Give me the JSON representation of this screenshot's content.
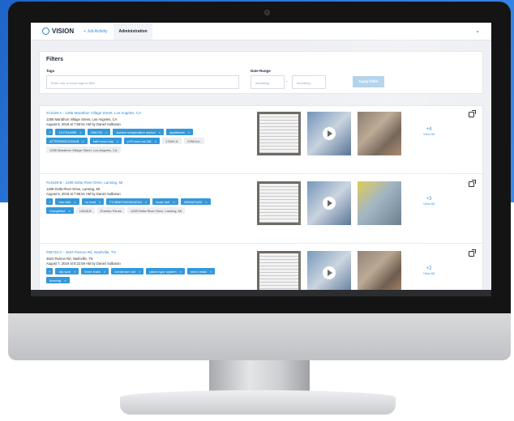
{
  "colors": {
    "accent": "#2d8ad8",
    "tag": "#3498db",
    "apply_button": "#a9cde9"
  },
  "nav": {
    "brand": "VISION",
    "link": "+ Job Activity",
    "tab": "Administration",
    "menu_icon": "chevron-down-icon",
    "menu_glyph": "⌄"
  },
  "filters": {
    "title": "Filters",
    "tags_label": "Tags",
    "tags_placeholder": "Enter one or more tags to filter",
    "date_label": "Date Range",
    "date_from_placeholder": "mm/dd/yy",
    "date_separator": "-",
    "date_to_placeholder": "mm/dd/yy",
    "apply_label": "Apply Filter"
  },
  "jobs": [
    {
      "title": "#13169-A - 1285 Marathon Village Street, Los Angeles, CA",
      "address": "1285 Marathon Village Street, Los Angeles, CA",
      "date": "August 8, 2019 at 7:56:51 AM by Daniel Sulbaran",
      "tags": [
        "+",
        "1107344855",
        "208/230",
        "suction temperature sensor",
        "applebees",
        "ATTRS530E1000AB",
        "half moon bay",
        "p70 oven sa-181"
      ],
      "meta": [
        "13169-A",
        "JOMI Inc.",
        "1285 Marathon Village Street, Los Angeles, CA"
      ],
      "more_count": "+4",
      "more_label": "View All"
    },
    {
      "title": "#14638-B - 1289 Delta River Drive, Lansing, MI",
      "address": "1289 Delta River Drive, Lansing, MI",
      "date": "August 8, 2019 at 7:55:51 AM by Daniel Sulbaran",
      "tags": [
        "+",
        "new belt",
        "no heat",
        "FC4BNF030000AEAA",
        "loose belt",
        "2896A23220",
        "Completed"
      ],
      "meta": [
        "14638-B",
        "Ernesto Farms",
        "1289 Delta River Drive, Lansing, MI"
      ],
      "more_count": "+3",
      "more_label": "View All"
    },
    {
      "title": "#58732-C - 4624 Parnon Rd, Nashville, TN",
      "address": "4624 Parnon Rd, Nashville, TN",
      "date": "August 7, 2019 at 8:22:59 AM by Daniel Sulbaran",
      "tags": [
        "+",
        "oily spot",
        "three leaks",
        "condenser coil",
        "piston type system",
        "micro leaks",
        "freezing"
      ],
      "meta": [],
      "more_count": "+2",
      "more_label": "View All"
    }
  ]
}
